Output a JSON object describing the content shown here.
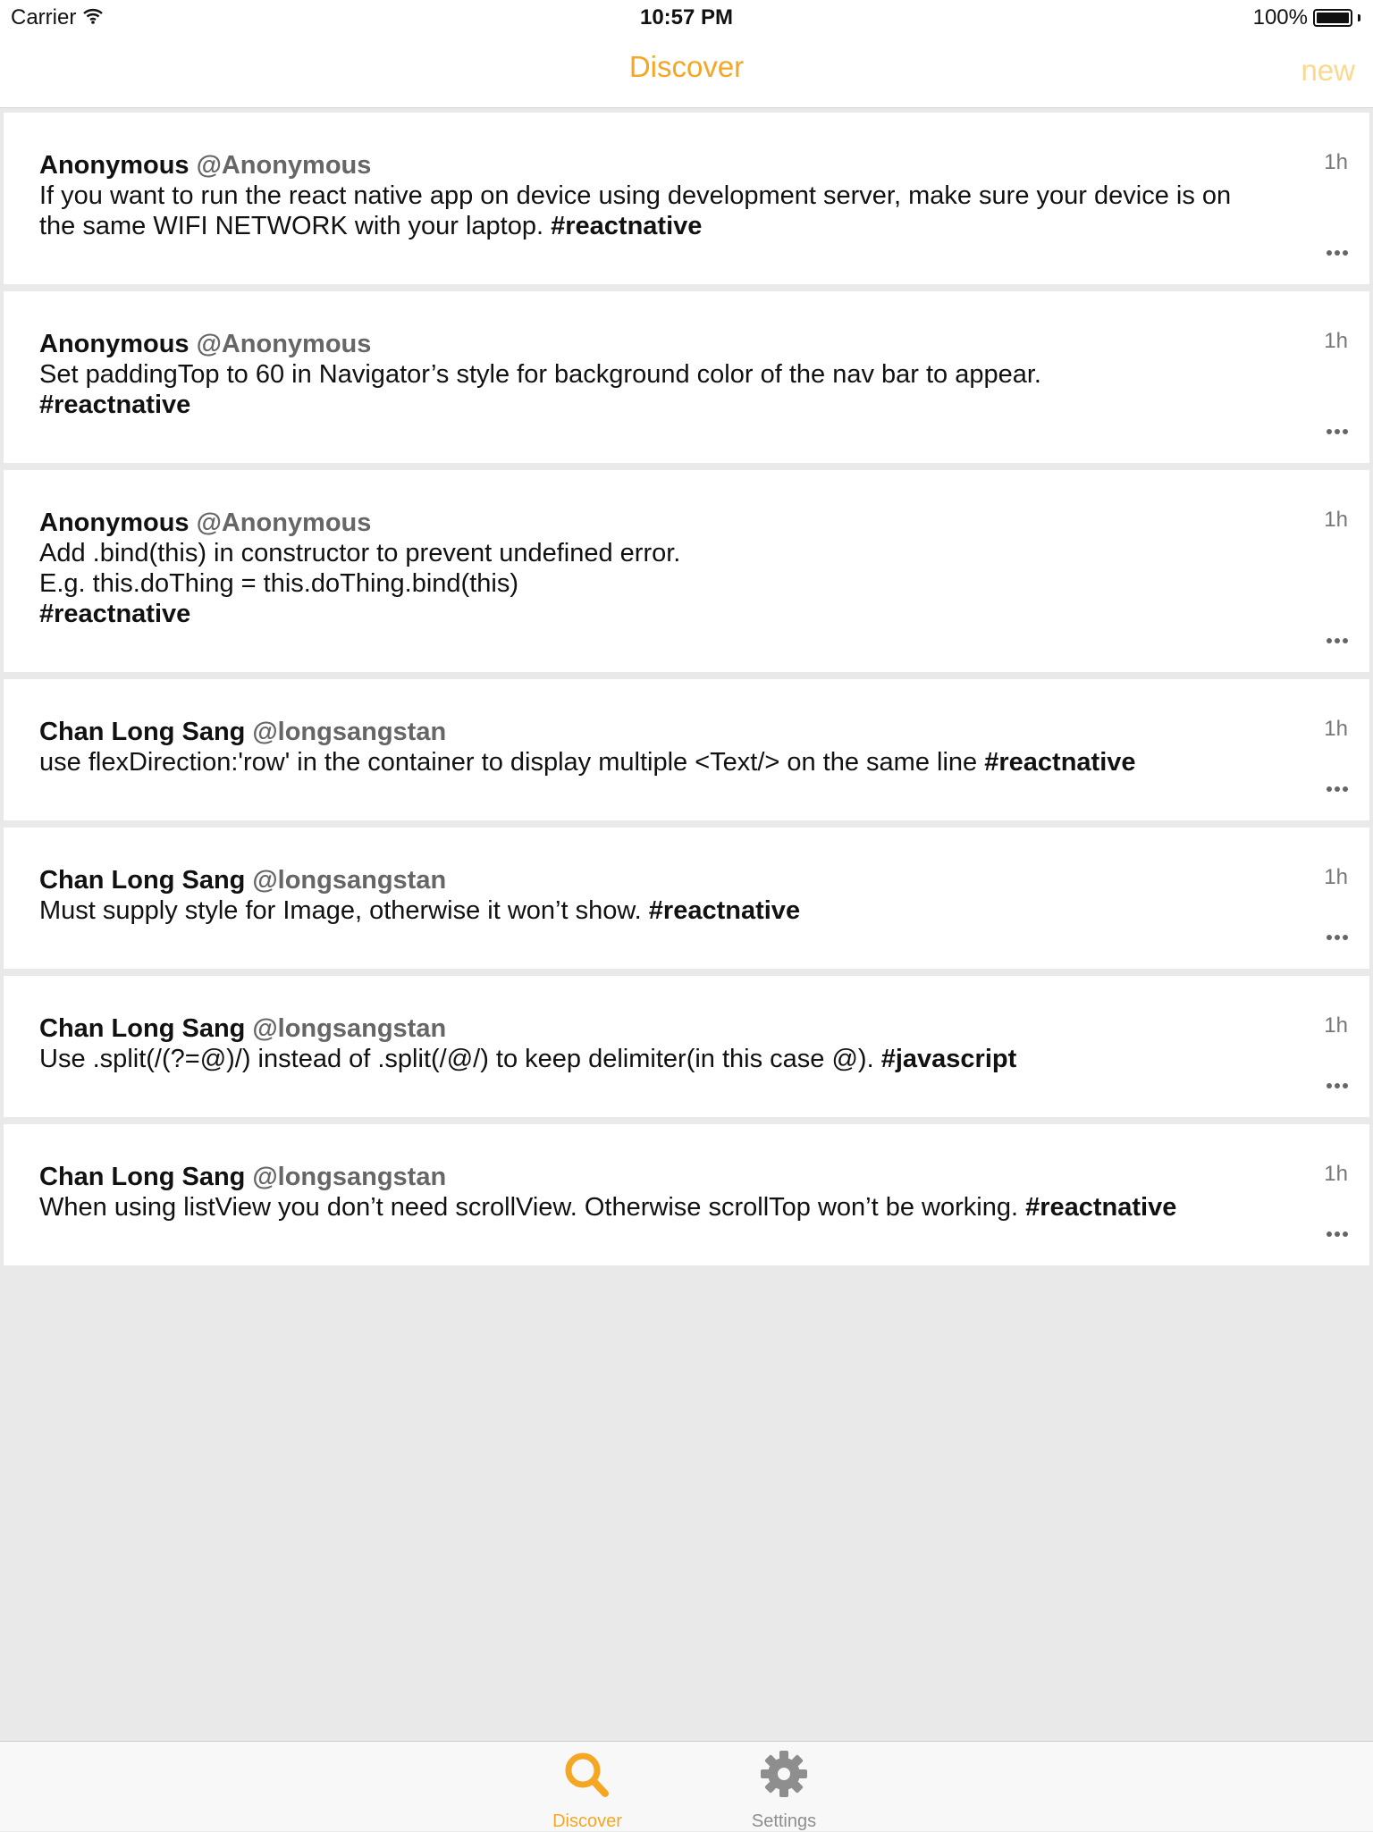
{
  "status_bar": {
    "carrier": "Carrier",
    "time": "10:57 PM",
    "battery": "100%"
  },
  "nav": {
    "title": "Discover",
    "right_button": "new"
  },
  "posts": [
    {
      "author": "Anonymous",
      "handle": "@Anonymous",
      "time": "1h",
      "text": "If you want to run the react native app on device using development server, make sure your device is on the same WIFI NETWORK with your laptop. ",
      "tag": "#reactnative"
    },
    {
      "author": "Anonymous",
      "handle": "@Anonymous",
      "time": "1h",
      "text": "Set paddingTop to 60 in Navigator’s style for background color of the nav bar to appear.\n",
      "tag": "#reactnative"
    },
    {
      "author": "Anonymous",
      "handle": "@Anonymous",
      "time": "1h",
      "text": "Add .bind(this) in constructor to prevent undefined error.\nE.g. this.doThing = this.doThing.bind(this)\n",
      "tag": "#reactnative"
    },
    {
      "author": "Chan Long Sang",
      "handle": "@longsangstan",
      "time": "1h",
      "text": "use flexDirection:'row' in the container to display multiple <Text/> on the same line ",
      "tag": "#reactnative"
    },
    {
      "author": "Chan Long Sang",
      "handle": "@longsangstan",
      "time": "1h",
      "text": "Must supply style for Image, otherwise it won’t show. ",
      "tag": "#reactnative"
    },
    {
      "author": "Chan Long Sang",
      "handle": "@longsangstan",
      "time": "1h",
      "text": "Use .split(/(?=@)/) instead of .split(/@/) to keep delimiter(in this case @). ",
      "tag": "#javascript"
    },
    {
      "author": "Chan Long Sang",
      "handle": "@longsangstan",
      "time": "1h",
      "text": "When using listView you don’t need scrollView. Otherwise scrollTop won’t be working. ",
      "tag": "#reactnative"
    }
  ],
  "tabs": {
    "discover": "Discover",
    "settings": "Settings"
  },
  "colors": {
    "accent": "#f5a623",
    "accent_light": "#fbd88f",
    "inactive_tab": "#8e8e8e",
    "background": "#e9e9e9"
  }
}
